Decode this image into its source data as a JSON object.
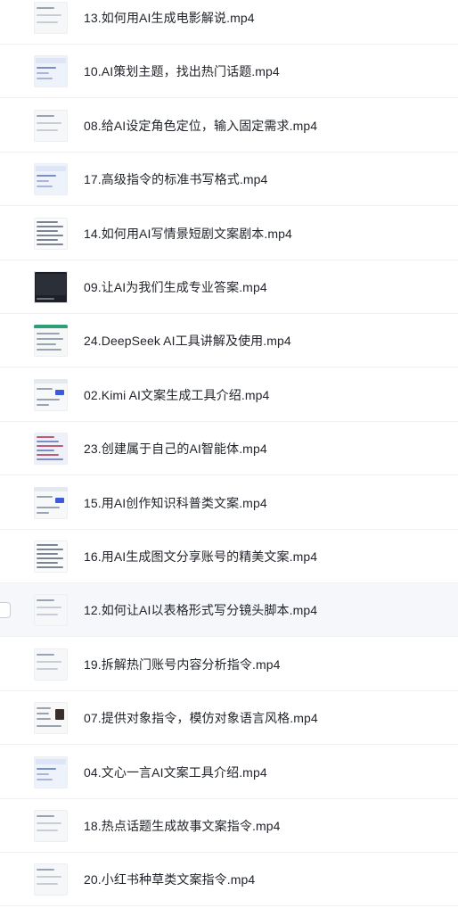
{
  "files": [
    {
      "name": "13.如何用AI生成电影解说.mp4",
      "thumb_style": "light"
    },
    {
      "name": "10.AI策划主题，找出热门话题.mp4",
      "thumb_style": "blue"
    },
    {
      "name": "08.给AI设定角色定位，输入固定需求.mp4",
      "thumb_style": "light"
    },
    {
      "name": "17.高级指令的标准书写格式.mp4",
      "thumb_style": "blue"
    },
    {
      "name": "14.如何用AI写情景短剧文案剧本.mp4",
      "thumb_style": "text"
    },
    {
      "name": "09.让AI为我们生成专业答案.mp4",
      "thumb_style": "dark"
    },
    {
      "name": "24.DeepSeek AI工具讲解及使用.mp4",
      "thumb_style": "green"
    },
    {
      "name": "02.Kimi AI文案生成工具介绍.mp4",
      "thumb_style": "ui"
    },
    {
      "name": "23.创建属于自己的AI智能体.mp4",
      "thumb_style": "dense"
    },
    {
      "name": "15.用AI创作知识科普类文案.mp4",
      "thumb_style": "ui"
    },
    {
      "name": "16.用AI生成图文分享账号的精美文案.mp4",
      "thumb_style": "text"
    },
    {
      "name": "12.如何让AI以表格形式写分镜头脚本.mp4",
      "thumb_style": "light",
      "highlighted": true
    },
    {
      "name": "19.拆解热门账号内容分析指令.mp4",
      "thumb_style": "light"
    },
    {
      "name": "07.提供对象指令，模仿对象语言风格.mp4",
      "thumb_style": "photo"
    },
    {
      "name": "04.文心一言AI文案工具介绍.mp4",
      "thumb_style": "blue"
    },
    {
      "name": "18.热点话题生成故事文案指令.mp4",
      "thumb_style": "light"
    },
    {
      "name": "20.小红书种草类文案指令.mp4",
      "thumb_style": "light"
    }
  ],
  "icons": {
    "row_checkbox": "checkbox-icon",
    "thumbnail": "video-thumbnail-icon"
  },
  "colors": {
    "text": "#1f2329",
    "divider": "#eef0f3",
    "highlight_row": "#f5f7fb"
  }
}
